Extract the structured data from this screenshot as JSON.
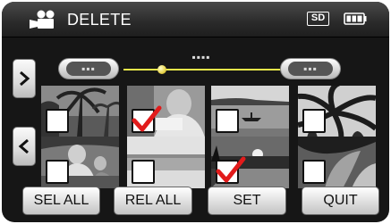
{
  "header": {
    "mode_icon": "video-camera-icon",
    "title": "DELETE",
    "media_badge": "SD",
    "battery_icon": "battery-full-icon"
  },
  "scrubber": {
    "position_pct": 22
  },
  "navigation": {
    "next_icon": "chevron-right-icon",
    "prev_icon": "chevron-left-icon"
  },
  "thumbnails": [
    {
      "scene": "palm trees at dusk",
      "checked": false
    },
    {
      "scene": "person reading",
      "checked": true
    },
    {
      "scene": "lake with rowboat",
      "checked": false
    },
    {
      "scene": "palm leaves against sky",
      "checked": false
    },
    {
      "scene": "man and child at table",
      "checked": false
    },
    {
      "scene": "beach with ocean",
      "checked": false
    },
    {
      "scene": "sunset over shore",
      "checked": true
    },
    {
      "scene": "tropical plants",
      "checked": false
    }
  ],
  "buttons": {
    "select_all": "SEL ALL",
    "release_all": "REL ALL",
    "set": "SET",
    "quit": "QUIT"
  },
  "colors": {
    "accent_track": "#e8e84a",
    "check_red": "#e21b1b",
    "background": "#161616"
  }
}
